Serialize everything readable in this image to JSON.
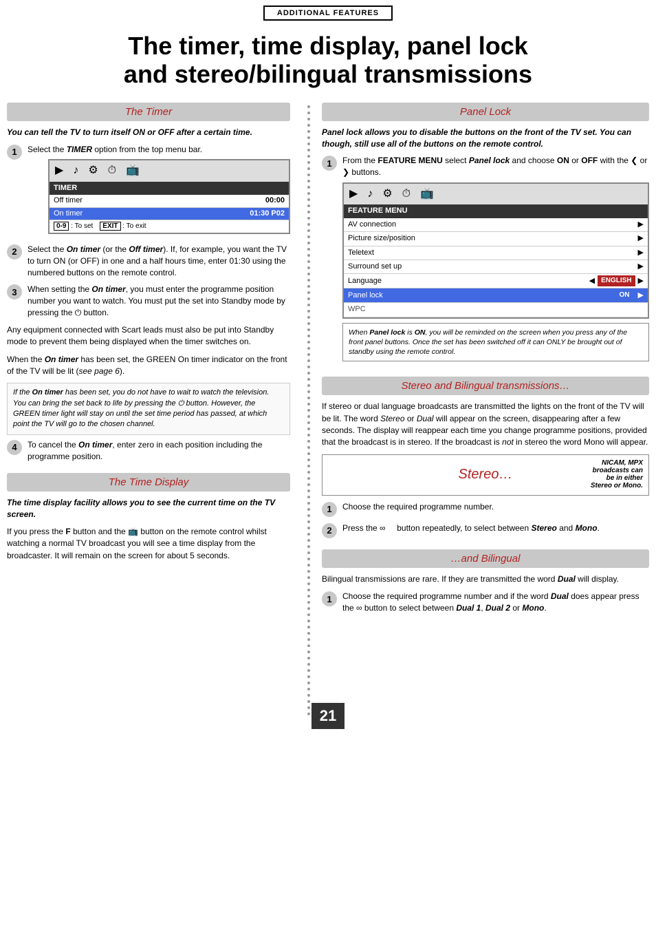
{
  "page": {
    "badge": "ADDITIONAL FEATURES",
    "main_title": "The timer, time display, panel lock\nand stereo/bilingual transmissions",
    "page_number": "21"
  },
  "left": {
    "timer_section": {
      "header": "The Timer",
      "intro": "You can tell the TV to turn itself ON or OFF after a certain time.",
      "step1": "Select the TIMER option from the top menu bar.",
      "menu": {
        "title": "TIMER",
        "rows": [
          {
            "label": "Off timer",
            "value": "00:00",
            "highlight": false
          },
          {
            "label": "On timer",
            "value": "01:30  P02",
            "highlight": true
          }
        ],
        "keys": [
          {
            "key": "0-9",
            "desc": ": To set"
          },
          {
            "key": "EXIT",
            "desc": ": To exit"
          }
        ]
      },
      "step2": "Select the On timer (or the Off timer). If, for example, you want the TV to turn ON (or OFF) in one and a half hours time, enter 01:30 using the numbered buttons on the remote control.",
      "step3_a": "When setting the On timer, you must enter the programme position number you want to watch. You must put the set into Standby mode by pressing the ⏻ button.",
      "step3_b": "Any equipment connected with Scart leads must also be put into Standby mode to prevent them being displayed when the timer switches on.",
      "step3_c": "When the On timer has been set, the GREEN On timer indicator on the front of the TV will be lit (see page 6).",
      "note": "If the On timer has been set, you do not have to wait to watch the television. You can bring the set back to life by pressing the ⏻ button. However, the GREEN timer light will stay on until the set time period has passed, at which point the TV will go to the chosen channel.",
      "step4": "To cancel the On timer, enter zero in each position including the programme position."
    },
    "time_display_section": {
      "header": "The Time Display",
      "intro": "The time display facility allows you to see the current time on the TV screen.",
      "body": "If you press the F button and the 📺 button on the remote control whilst watching a normal TV broadcast you will see a time display from the broadcaster. It will remain on the screen for about 5 seconds."
    }
  },
  "right": {
    "panel_lock_section": {
      "header": "Panel Lock",
      "intro": "Panel lock allows you to disable the buttons on the front of the TV set. You can though, still use all of the buttons on the remote control.",
      "step1": "From the FEATURE MENU select Panel lock and choose ON or OFF with the ❮ or ❯ buttons.",
      "menu": {
        "title": "FEATURE MENU",
        "rows": [
          {
            "label": "AV connection",
            "value": "▶",
            "highlight": false
          },
          {
            "label": "Picture size/position",
            "value": "▶",
            "highlight": false
          },
          {
            "label": "Teletext",
            "value": "▶",
            "highlight": false
          },
          {
            "label": "Surround set up",
            "value": "▶",
            "highlight": false
          },
          {
            "label": "Language",
            "value_badge": "ENGLISH",
            "value": "▶",
            "highlight": false
          },
          {
            "label": "Panel lock",
            "value_badge": "ON",
            "value": "▶",
            "highlight": true
          },
          {
            "label": "WPC",
            "value": "",
            "highlight": false,
            "partial": true
          }
        ]
      },
      "warning": "When Panel lock is ON, you will be reminded on the screen when you press any of the front panel buttons. Once the set has been switched off it can ONLY be brought out of standby using the remote control."
    },
    "stereo_section": {
      "header": "Stereo and Bilingual transmissions…",
      "body": "If stereo or dual language broadcasts are transmitted the lights on the front of the TV will be lit. The word Stereo or Dual will appear on the screen, disappearing after a few seconds. The display will reappear each time you change programme positions, provided that the broadcast is in stereo. If the broadcast is not in stereo the word Mono will appear.",
      "stereo_box_label": "Stereo…",
      "stereo_note": "NICAM, MPX broadcasts can be in either Stereo or Mono.",
      "step1": "Choose the required programme number.",
      "step2": "Press the ∞ button repeatedly, to select between Stereo and Mono."
    },
    "bilingual_section": {
      "header": "…and Bilingual",
      "body1": "Bilingual transmissions are rare. If they are transmitted the word Dual will display.",
      "step1": "Choose the required programme number and if the word Dual does appear press the ∞ button to select between Dual 1, Dual 2 or Mono."
    }
  }
}
